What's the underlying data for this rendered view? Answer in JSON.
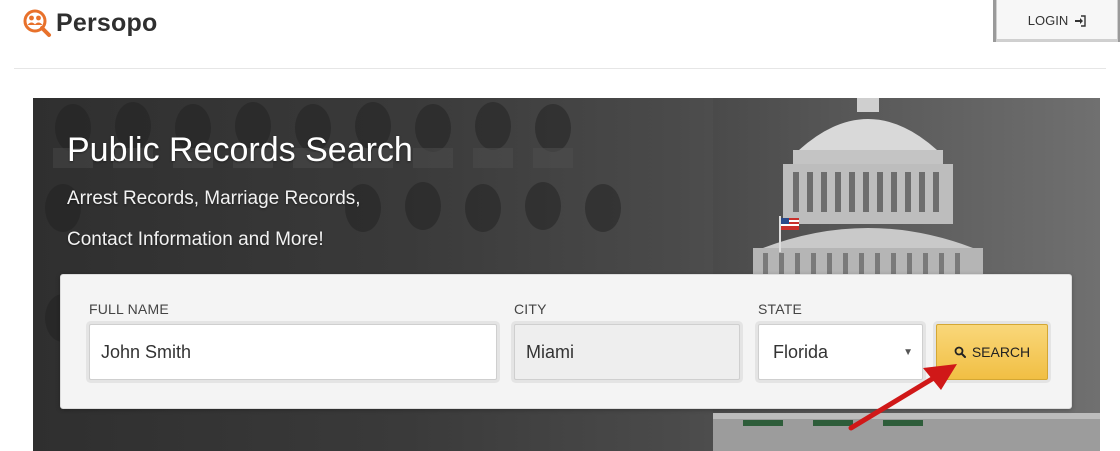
{
  "header": {
    "brand": "Persopo",
    "login_label": "LOGIN",
    "login_icon": "sign-in-icon"
  },
  "hero": {
    "title": "Public Records Search",
    "subtitle_line1": "Arrest Records, Marriage Records,",
    "subtitle_line2": "Contact Information and More!"
  },
  "search": {
    "full_name_label": "FULL NAME",
    "full_name_value": "John Smith",
    "city_label": "CITY",
    "city_value": "Miami",
    "state_label": "STATE",
    "state_value": "Florida",
    "button_label": "SEARCH",
    "button_icon": "search-icon"
  },
  "colors": {
    "search_button": "#f1bf44",
    "arrow": "#d01818",
    "logo_accent": "#e8712b"
  }
}
